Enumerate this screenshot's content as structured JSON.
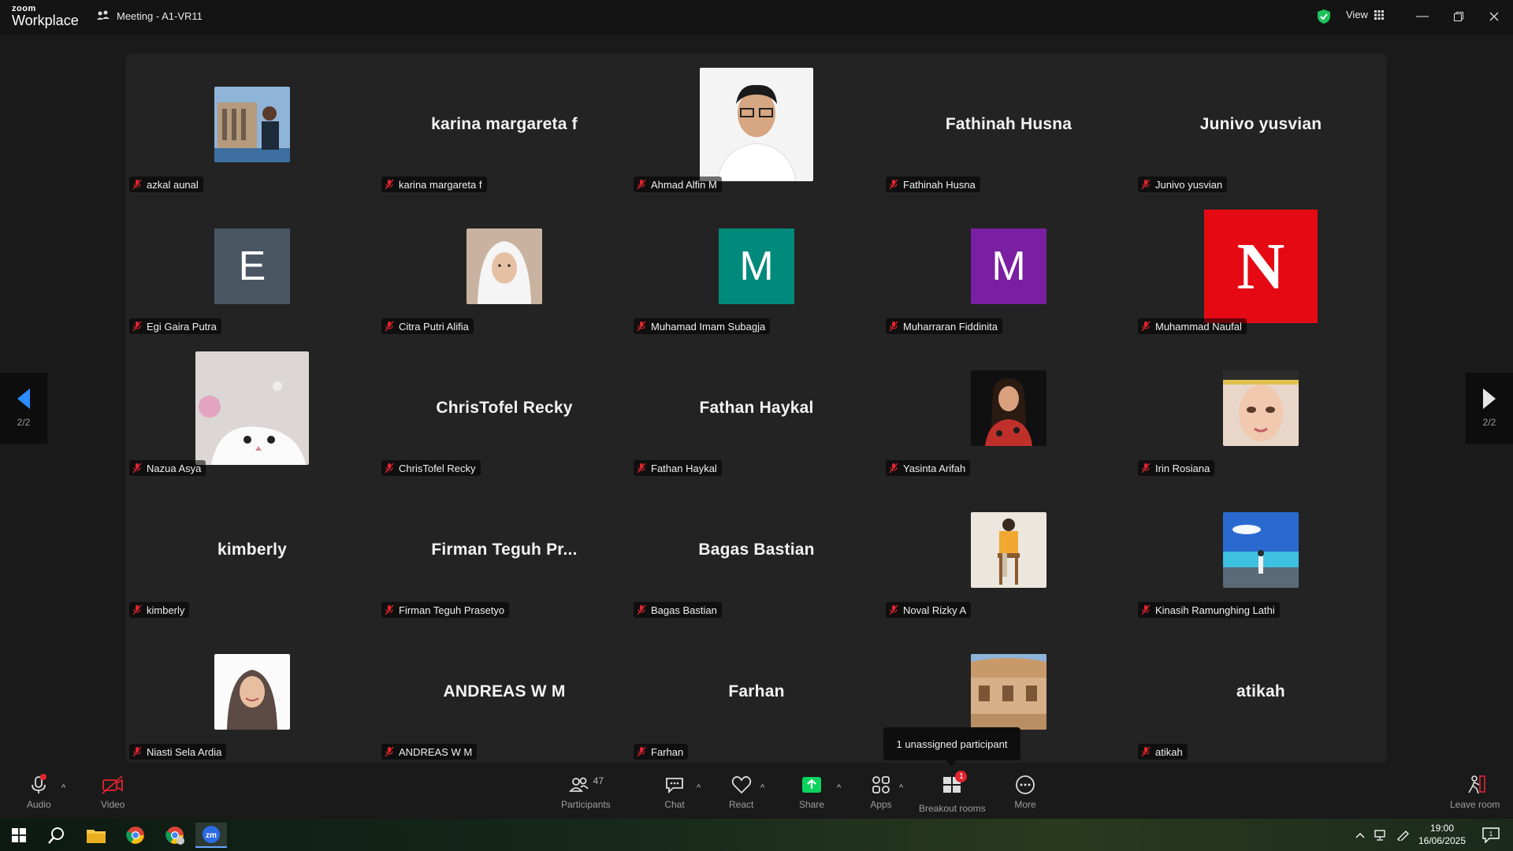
{
  "app": {
    "logo_top": "zoom",
    "logo_bottom": "Workplace"
  },
  "meeting": {
    "title": "Meeting - A1-VR11"
  },
  "titlebar": {
    "view_label": "View"
  },
  "pagination": {
    "left": "2/2",
    "right": "2/2"
  },
  "participants": [
    {
      "name": "azkal aunal",
      "display": "photo",
      "photo": "temple"
    },
    {
      "name": "karina margareta f",
      "display": "name",
      "big": "karina margareta f"
    },
    {
      "name": "Ahmad Alfin M",
      "display": "photo",
      "photo": "man-white-shirt"
    },
    {
      "name": "Fathinah Husna",
      "display": "name",
      "big": "Fathinah Husna"
    },
    {
      "name": "Junivo yusvian",
      "display": "name",
      "big": "Junivo yusvian"
    },
    {
      "name": "Egi Gaira Putra",
      "display": "initial",
      "initial": "E",
      "color": "#4a5763"
    },
    {
      "name": "Citra Putri Alifia",
      "display": "photo",
      "photo": "hijab-white"
    },
    {
      "name": "Muhamad Imam Subagja",
      "display": "initial",
      "initial": "M",
      "color": "#008a7c"
    },
    {
      "name": "Muharraran Fiddinita",
      "display": "initial",
      "initial": "M",
      "color": "#7b1fa2"
    },
    {
      "name": "Muhammad Naufal",
      "display": "netflix",
      "initial": "N",
      "color": "#e50914"
    },
    {
      "name": "Nazua Asya",
      "display": "photo",
      "photo": "cat"
    },
    {
      "name": "ChrisTofel Recky",
      "display": "name",
      "big": "ChrisTofel Recky"
    },
    {
      "name": "Fathan Haykal",
      "display": "name",
      "big": "Fathan Haykal"
    },
    {
      "name": "Yasinta Arifah",
      "display": "photo",
      "photo": "woman-red"
    },
    {
      "name": "Irin Rosiana",
      "display": "photo",
      "photo": "woman-cap"
    },
    {
      "name": "kimberly",
      "display": "name",
      "big": "kimberly"
    },
    {
      "name": "Firman Teguh Prasetyo",
      "display": "name",
      "big": "Firman Teguh Pr..."
    },
    {
      "name": "Bagas Bastian",
      "display": "name",
      "big": "Bagas Bastian"
    },
    {
      "name": "Noval Rizky A",
      "display": "photo",
      "photo": "man-stool"
    },
    {
      "name": "Kinasih Ramunghing Lathi",
      "display": "photo",
      "photo": "beach"
    },
    {
      "name": "Niasti Sela Ardia",
      "display": "photo",
      "photo": "hijab-smile"
    },
    {
      "name": "ANDREAS W M",
      "display": "name",
      "big": "ANDREAS W M"
    },
    {
      "name": "Farhan",
      "display": "name",
      "big": "Farhan"
    },
    {
      "name": "",
      "display": "photo",
      "photo": "building"
    },
    {
      "name": "atikah",
      "display": "name",
      "big": "atikah"
    }
  ],
  "tooltip": {
    "text": "1 unassigned participant"
  },
  "toolbar": {
    "audio": "Audio",
    "video": "Video",
    "participants": "Participants",
    "participants_count": "47",
    "chat": "Chat",
    "react": "React",
    "share": "Share",
    "apps": "Apps",
    "breakout": "Breakout rooms",
    "breakout_badge": "1",
    "more": "More",
    "leave": "Leave room"
  },
  "taskbar": {
    "time": "19:00",
    "date": "16/06/2025",
    "notif_count": "1"
  },
  "colors": {
    "stage": "#232323",
    "muted_red": "#e0242e",
    "share_green": "#0bd35e",
    "nav_arrow": "#2d8cff"
  }
}
